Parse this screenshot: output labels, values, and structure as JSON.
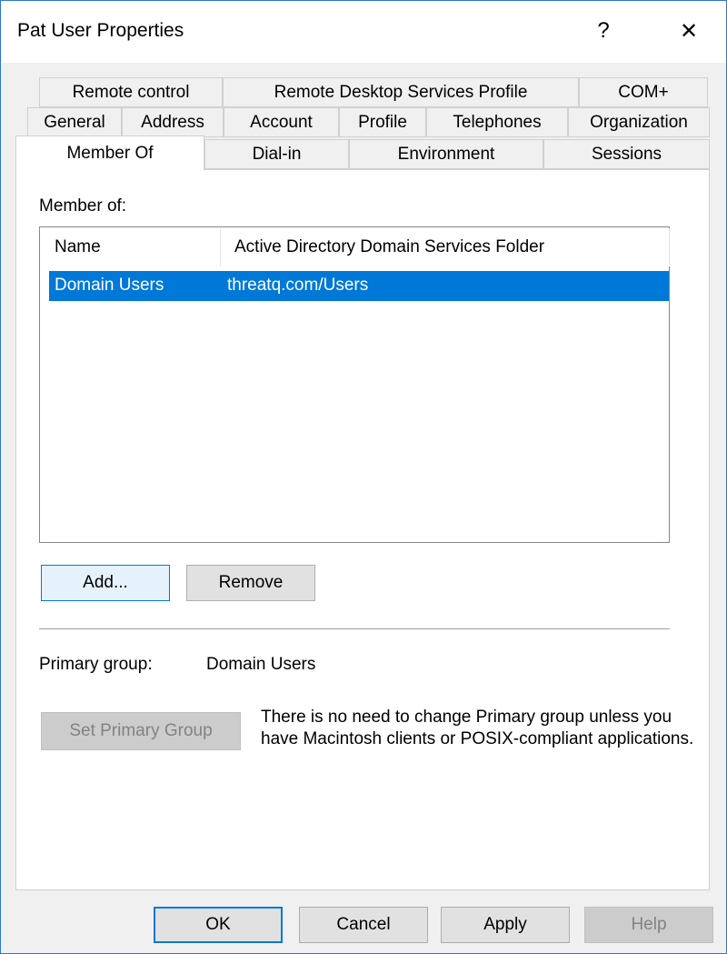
{
  "window": {
    "title": "Pat User Properties",
    "help_glyph": "?",
    "close_glyph": "✕"
  },
  "tabs": {
    "row1": [
      "Remote control",
      "Remote Desktop Services Profile",
      "COM+"
    ],
    "row2": [
      "General",
      "Address",
      "Account",
      "Profile",
      "Telephones",
      "Organization"
    ],
    "row3": [
      "Member Of",
      "Dial-in",
      "Environment",
      "Sessions"
    ],
    "active": "Member Of"
  },
  "member_of": {
    "label": "Member of:",
    "columns": [
      "Name",
      "Active Directory Domain Services Folder"
    ],
    "rows": [
      {
        "name": "Domain Users",
        "folder": "threatq.com/Users",
        "selected": true
      }
    ]
  },
  "buttons": {
    "add": "Add...",
    "remove": "Remove",
    "set_primary": "Set Primary Group",
    "ok": "OK",
    "cancel": "Cancel",
    "apply": "Apply",
    "help": "Help"
  },
  "primary_group": {
    "label": "Primary group:",
    "value": "Domain Users",
    "note": "There is no need to change Primary group unless you have Macintosh clients or POSIX-compliant applications."
  },
  "colors": {
    "selection": "#0078d7",
    "window_border": "#2b79c6",
    "panel_bg": "#ffffff",
    "dialog_bg": "#f0f0f0"
  }
}
